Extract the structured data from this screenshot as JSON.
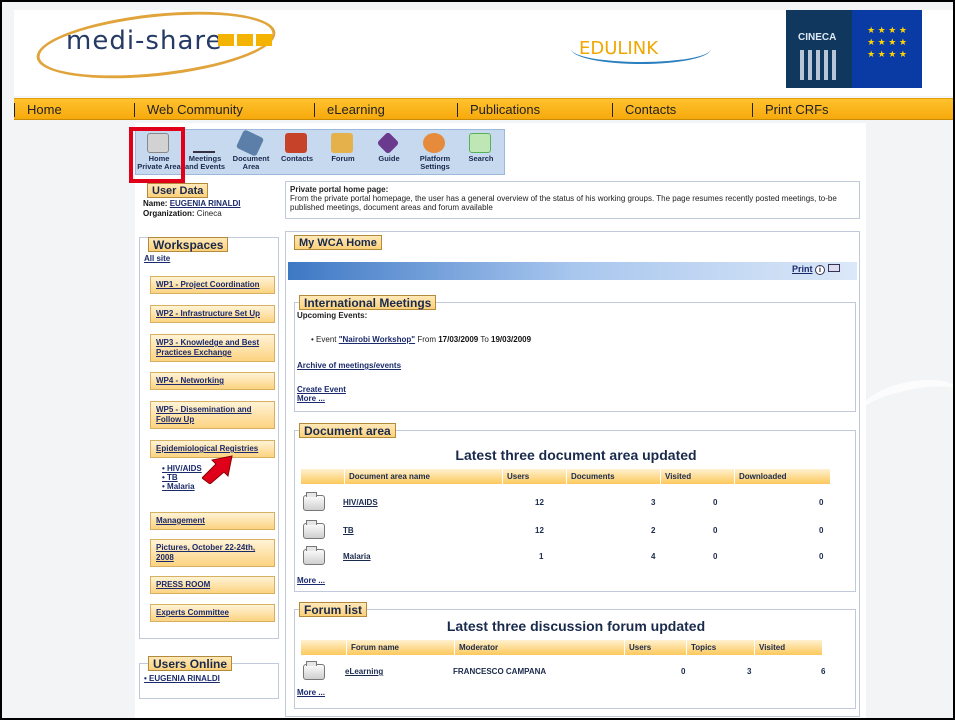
{
  "header": {
    "logo_text": "medi-share",
    "partner_logo_1": "EDULINK",
    "partner_logo_2": "CINECA",
    "partner_logo_3_stars": "★ ★ ★ ★ ★ ★ ★ ★ ★ ★ ★ ★"
  },
  "nav": {
    "items": [
      "Home",
      "Web Community",
      "eLearning",
      "Publications",
      "Contacts",
      "Print CRFs"
    ]
  },
  "toolbar": {
    "items": [
      {
        "label": "Home Private Area",
        "icon": "home-icon",
        "color": "#d2d2d2"
      },
      {
        "label": "Meetings and Events",
        "icon": "meetings-icon",
        "color": "#ffffff"
      },
      {
        "label": "Document Area",
        "icon": "document-icon",
        "color": "#5b7fa8"
      },
      {
        "label": "Contacts",
        "icon": "contacts-icon",
        "color": "#c6432a"
      },
      {
        "label": "Forum",
        "icon": "forum-icon",
        "color": "#e4b14b"
      },
      {
        "label": "Guide",
        "icon": "guide-icon",
        "color": "#6a3b8c"
      },
      {
        "label": "Platform Settings",
        "icon": "settings-icon",
        "color": "#e58b3b"
      },
      {
        "label": "Search",
        "icon": "search-icon",
        "color": "#58b05a"
      }
    ]
  },
  "user_data": {
    "title": "User Data",
    "name_label": "Name:",
    "name": "EUGENIA RINALDI",
    "org_label": "Organization:",
    "org": "Cineca"
  },
  "intro": {
    "heading": "Private portal home page:",
    "text": "From the private portal homepage, the user has a general overview of the status of his working groups. The page resumes recently posted meetings, to-be published meetings, document areas and forum available"
  },
  "workspaces": {
    "title": "Workspaces",
    "all_site": "All site",
    "items": [
      "WP1 - Project Coordination",
      "WP2 - Infrastructure Set Up",
      "WP3 - Knowledge and Best Practices Exchange",
      "WP4 - Networking",
      "WP5 - Dissemination and Follow Up",
      "Epidemiological Registries",
      "Management",
      "Pictures, October 22-24th, 2008",
      "PRESS ROOM",
      "Experts Committee"
    ],
    "registries": [
      "HIV/AIDS",
      "TB",
      "Malaria"
    ]
  },
  "users_online": {
    "title": "Users Online",
    "users": [
      "EUGENIA RINALDI"
    ]
  },
  "home": {
    "title": "My WCA Home",
    "print": "Print"
  },
  "meetings": {
    "title": "International Meetings",
    "upcoming": "Upcoming Events:",
    "event_prefix": "Event",
    "event_name": "\"Nairobi Workshop\"",
    "event_from_label": "From",
    "event_from": "17/03/2009",
    "event_to_label": "To",
    "event_to": "19/03/2009",
    "archive": "Archive of meetings/events",
    "create": "Create Event",
    "more": "More ..."
  },
  "documents": {
    "title": "Document area",
    "heading": "Latest three document area updated",
    "columns": [
      "Document area name",
      "Users",
      "Documents",
      "Visited",
      "Downloaded"
    ],
    "rows": [
      {
        "name": "HIV/AIDS",
        "users": "12",
        "documents": "3",
        "visited": "0",
        "downloaded": "0"
      },
      {
        "name": "TB",
        "users": "12",
        "documents": "2",
        "visited": "0",
        "downloaded": "0"
      },
      {
        "name": "Malaria",
        "users": "1",
        "documents": "4",
        "visited": "0",
        "downloaded": "0"
      }
    ],
    "more": "More ..."
  },
  "forum": {
    "title": "Forum list",
    "heading": "Latest three discussion forum updated",
    "columns": [
      "Forum name",
      "Moderator",
      "Users",
      "Topics",
      "Visited"
    ],
    "rows": [
      {
        "name": "eLearning",
        "moderator": "FRANCESCO CAMPANA",
        "users": "0",
        "topics": "3",
        "visited": "6"
      }
    ],
    "more": "More ..."
  },
  "colors": {
    "nav_orange": "#f6a90c",
    "highlight_red": "#e0001a",
    "toolbar_blue": "#c6d9ef",
    "link_blue": "#1a2a6c"
  }
}
